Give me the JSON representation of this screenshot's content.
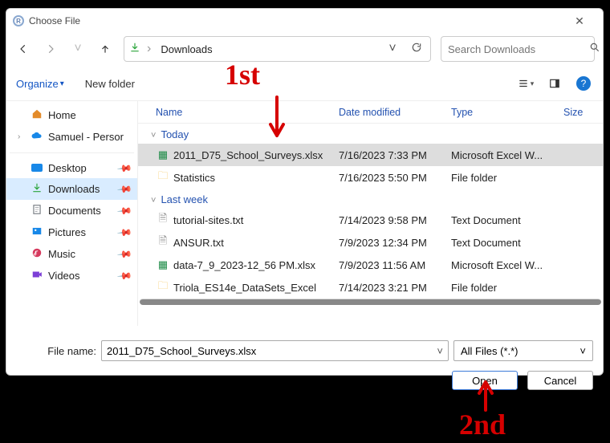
{
  "titlebar": {
    "title": "Choose File"
  },
  "nav": {
    "location": "Downloads"
  },
  "search": {
    "placeholder": "Search Downloads"
  },
  "toolbar": {
    "organize": "Organize",
    "newFolder": "New folder"
  },
  "tree": {
    "home": "Home",
    "user": "Samuel - Persor",
    "quick": [
      {
        "label": "Desktop"
      },
      {
        "label": "Downloads"
      },
      {
        "label": "Documents"
      },
      {
        "label": "Pictures"
      },
      {
        "label": "Music"
      },
      {
        "label": "Videos"
      }
    ]
  },
  "columns": {
    "name": "Name",
    "date": "Date modified",
    "type": "Type",
    "size": "Size"
  },
  "groups": {
    "today": {
      "label": "Today",
      "rows": [
        {
          "icon": "xls",
          "name": "2011_D75_School_Surveys.xlsx",
          "date": "7/16/2023 7:33 PM",
          "type": "Microsoft Excel W...",
          "selected": true
        },
        {
          "icon": "folder",
          "name": "Statistics",
          "date": "7/16/2023 5:50 PM",
          "type": "File folder"
        }
      ]
    },
    "lastweek": {
      "label": "Last week",
      "rows": [
        {
          "icon": "txt",
          "name": "tutorial-sites.txt",
          "date": "7/14/2023 9:58 PM",
          "type": "Text Document"
        },
        {
          "icon": "txt",
          "name": "ANSUR.txt",
          "date": "7/9/2023 12:34 PM",
          "type": "Text Document"
        },
        {
          "icon": "xls",
          "name": "data-7_9_2023-12_56 PM.xlsx",
          "date": "7/9/2023 11:56 AM",
          "type": "Microsoft Excel W..."
        },
        {
          "icon": "folder",
          "name": "Triola_ES14e_DataSets_Excel",
          "date": "7/14/2023 3:21 PM",
          "type": "File folder"
        }
      ]
    }
  },
  "footer": {
    "fileNameLabel": "File name:",
    "fileName": "2011_D75_School_Surveys.xlsx",
    "filter": "All Files (*.*)",
    "open": "Open",
    "cancel": "Cancel"
  },
  "annotations": {
    "first": "1st",
    "second": "2nd"
  }
}
